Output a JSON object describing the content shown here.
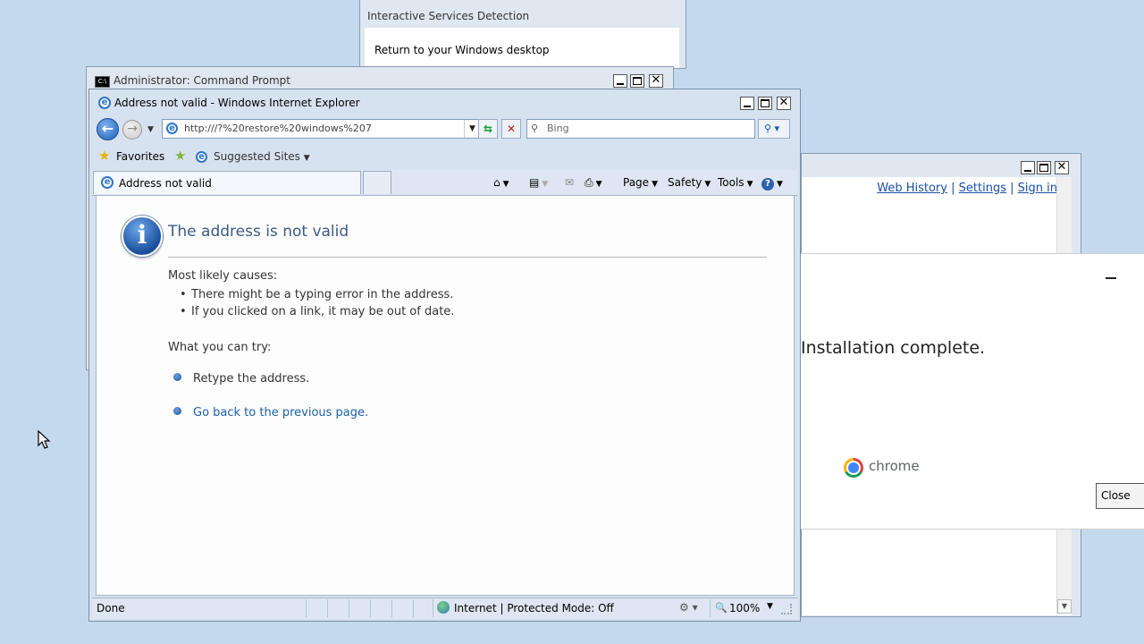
{
  "isd": {
    "title": "Interactive Services Detection",
    "body_text": "Return to your Windows desktop"
  },
  "cmd": {
    "title": "Administrator:  Command Prompt",
    "icon_text": "C:\\"
  },
  "ie_back": {
    "links": [
      "Web History",
      "Settings",
      "Sign in"
    ],
    "separator": "|"
  },
  "chrome_installer": {
    "message": "Installation complete.",
    "brand": "chrome",
    "close_label": "Close"
  },
  "ie": {
    "title": "Address not valid - Windows Internet Explorer",
    "address": "http:///?%20restore%20windows%207",
    "search_placeholder": "Bing",
    "favorites_label": "Favorites",
    "suggested_sites_label": "Suggested Sites",
    "tab_label": "Address not valid",
    "commands": {
      "page": "Page",
      "safety": "Safety",
      "tools": "Tools"
    },
    "page": {
      "heading": "The address is not valid",
      "causes_header": "Most likely causes:",
      "causes": [
        "There might be a typing error in the address.",
        "If you clicked on a link, it may be out of date."
      ],
      "try_header": "What you can try:",
      "try_items": [
        "Retype the address.",
        "Go back to the previous page."
      ]
    },
    "status": {
      "left": "Done",
      "zone": "Internet | Protected Mode: Off",
      "zoom": "100%"
    }
  },
  "colors": {
    "desktop": "#c5d9ee",
    "link": "#1d5fa6",
    "heading": "#3c5a85"
  },
  "icons": [
    "ie-icon",
    "back-arrow-icon",
    "forward-arrow-icon",
    "refresh-icon",
    "stop-icon",
    "search-icon",
    "favorites-star-icon",
    "add-favorites-icon",
    "home-icon",
    "rss-feeds-icon",
    "print-icon",
    "help-icon",
    "info-icon",
    "globe-icon",
    "zoom-icon",
    "chrome-logo-icon",
    "mouse-cursor-icon"
  ]
}
